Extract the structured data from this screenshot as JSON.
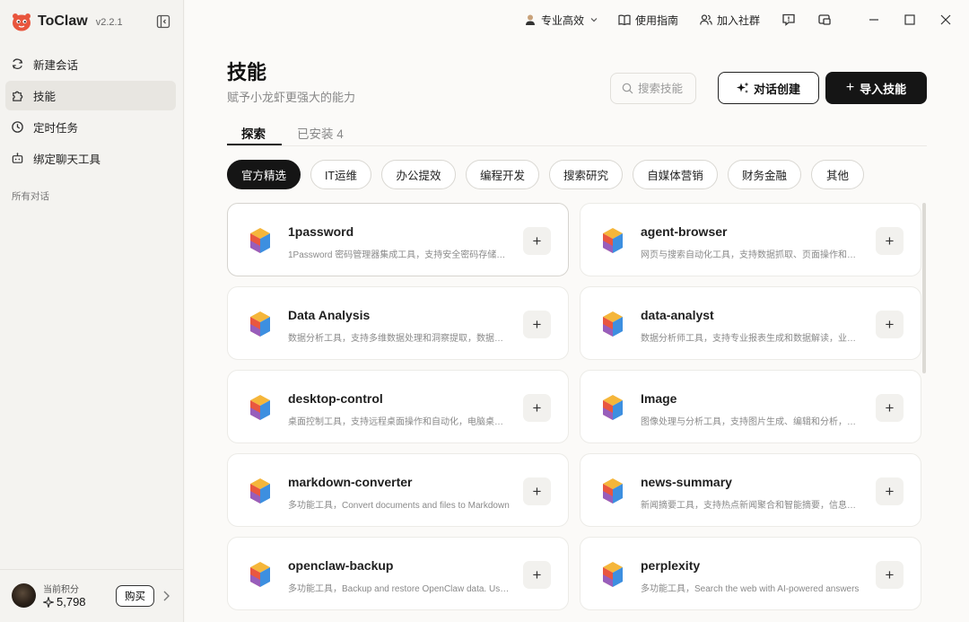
{
  "app": {
    "name": "ToClaw",
    "version": "v2.2.1"
  },
  "sidebar": {
    "items": [
      {
        "label": "新建会话",
        "icon": "new-chat-icon"
      },
      {
        "label": "技能",
        "icon": "puzzle-icon"
      },
      {
        "label": "定时任务",
        "icon": "clock-icon"
      },
      {
        "label": "绑定聊天工具",
        "icon": "robot-icon"
      }
    ],
    "section_label": "所有对话",
    "points": {
      "label": "当前积分",
      "value": "5,798",
      "buy_label": "购买"
    }
  },
  "topbar": {
    "mode_label": "专业高效",
    "guide_label": "使用指南",
    "community_label": "加入社群"
  },
  "page": {
    "title": "技能",
    "subtitle": "赋予小龙虾更强大的能力",
    "search_placeholder": "搜索技能",
    "dialog_create_label": "对话创建",
    "import_label": "导入技能",
    "import_plus": "+",
    "tabs": [
      {
        "label": "探索"
      },
      {
        "label": "已安装 4"
      }
    ]
  },
  "categories": [
    "官方精选",
    "IT运维",
    "办公提效",
    "编程开发",
    "搜索研究",
    "自媒体营销",
    "财务金融",
    "其他"
  ],
  "skills": [
    {
      "name": "1password",
      "desc": "1Password 密码管理器集成工具，支持安全密码存储和管理"
    },
    {
      "name": "agent-browser",
      "desc": "网页与搜索自动化工具，支持数据抓取、页面操作和信息提取"
    },
    {
      "name": "Data Analysis",
      "desc": "数据分析工具，支持多维数据处理和洞察提取，数据可视化呈现"
    },
    {
      "name": "data-analyst",
      "desc": "数据分析师工具，支持专业报表生成和数据解读，业务洞察"
    },
    {
      "name": "desktop-control",
      "desc": "桌面控制工具，支持远程桌面操作和自动化，电脑桌面管理"
    },
    {
      "name": "Image",
      "desc": "图像处理与分析工具，支持图片生成、编辑和分析，视觉识别"
    },
    {
      "name": "markdown-converter",
      "desc": "多功能工具，Convert documents and files to Markdown"
    },
    {
      "name": "news-summary",
      "desc": "新闻摘要工具，支持热点新闻聚合和智能摘要，信息速览"
    },
    {
      "name": "openclaw-backup",
      "desc": "多功能工具，Backup and restore OpenClaw data. Use when"
    },
    {
      "name": "perplexity",
      "desc": "多功能工具，Search the web with AI-powered answers"
    }
  ],
  "add_symbol": "+",
  "colors": {
    "accent_dark": "#151515",
    "brand_red": "#e8553d"
  }
}
